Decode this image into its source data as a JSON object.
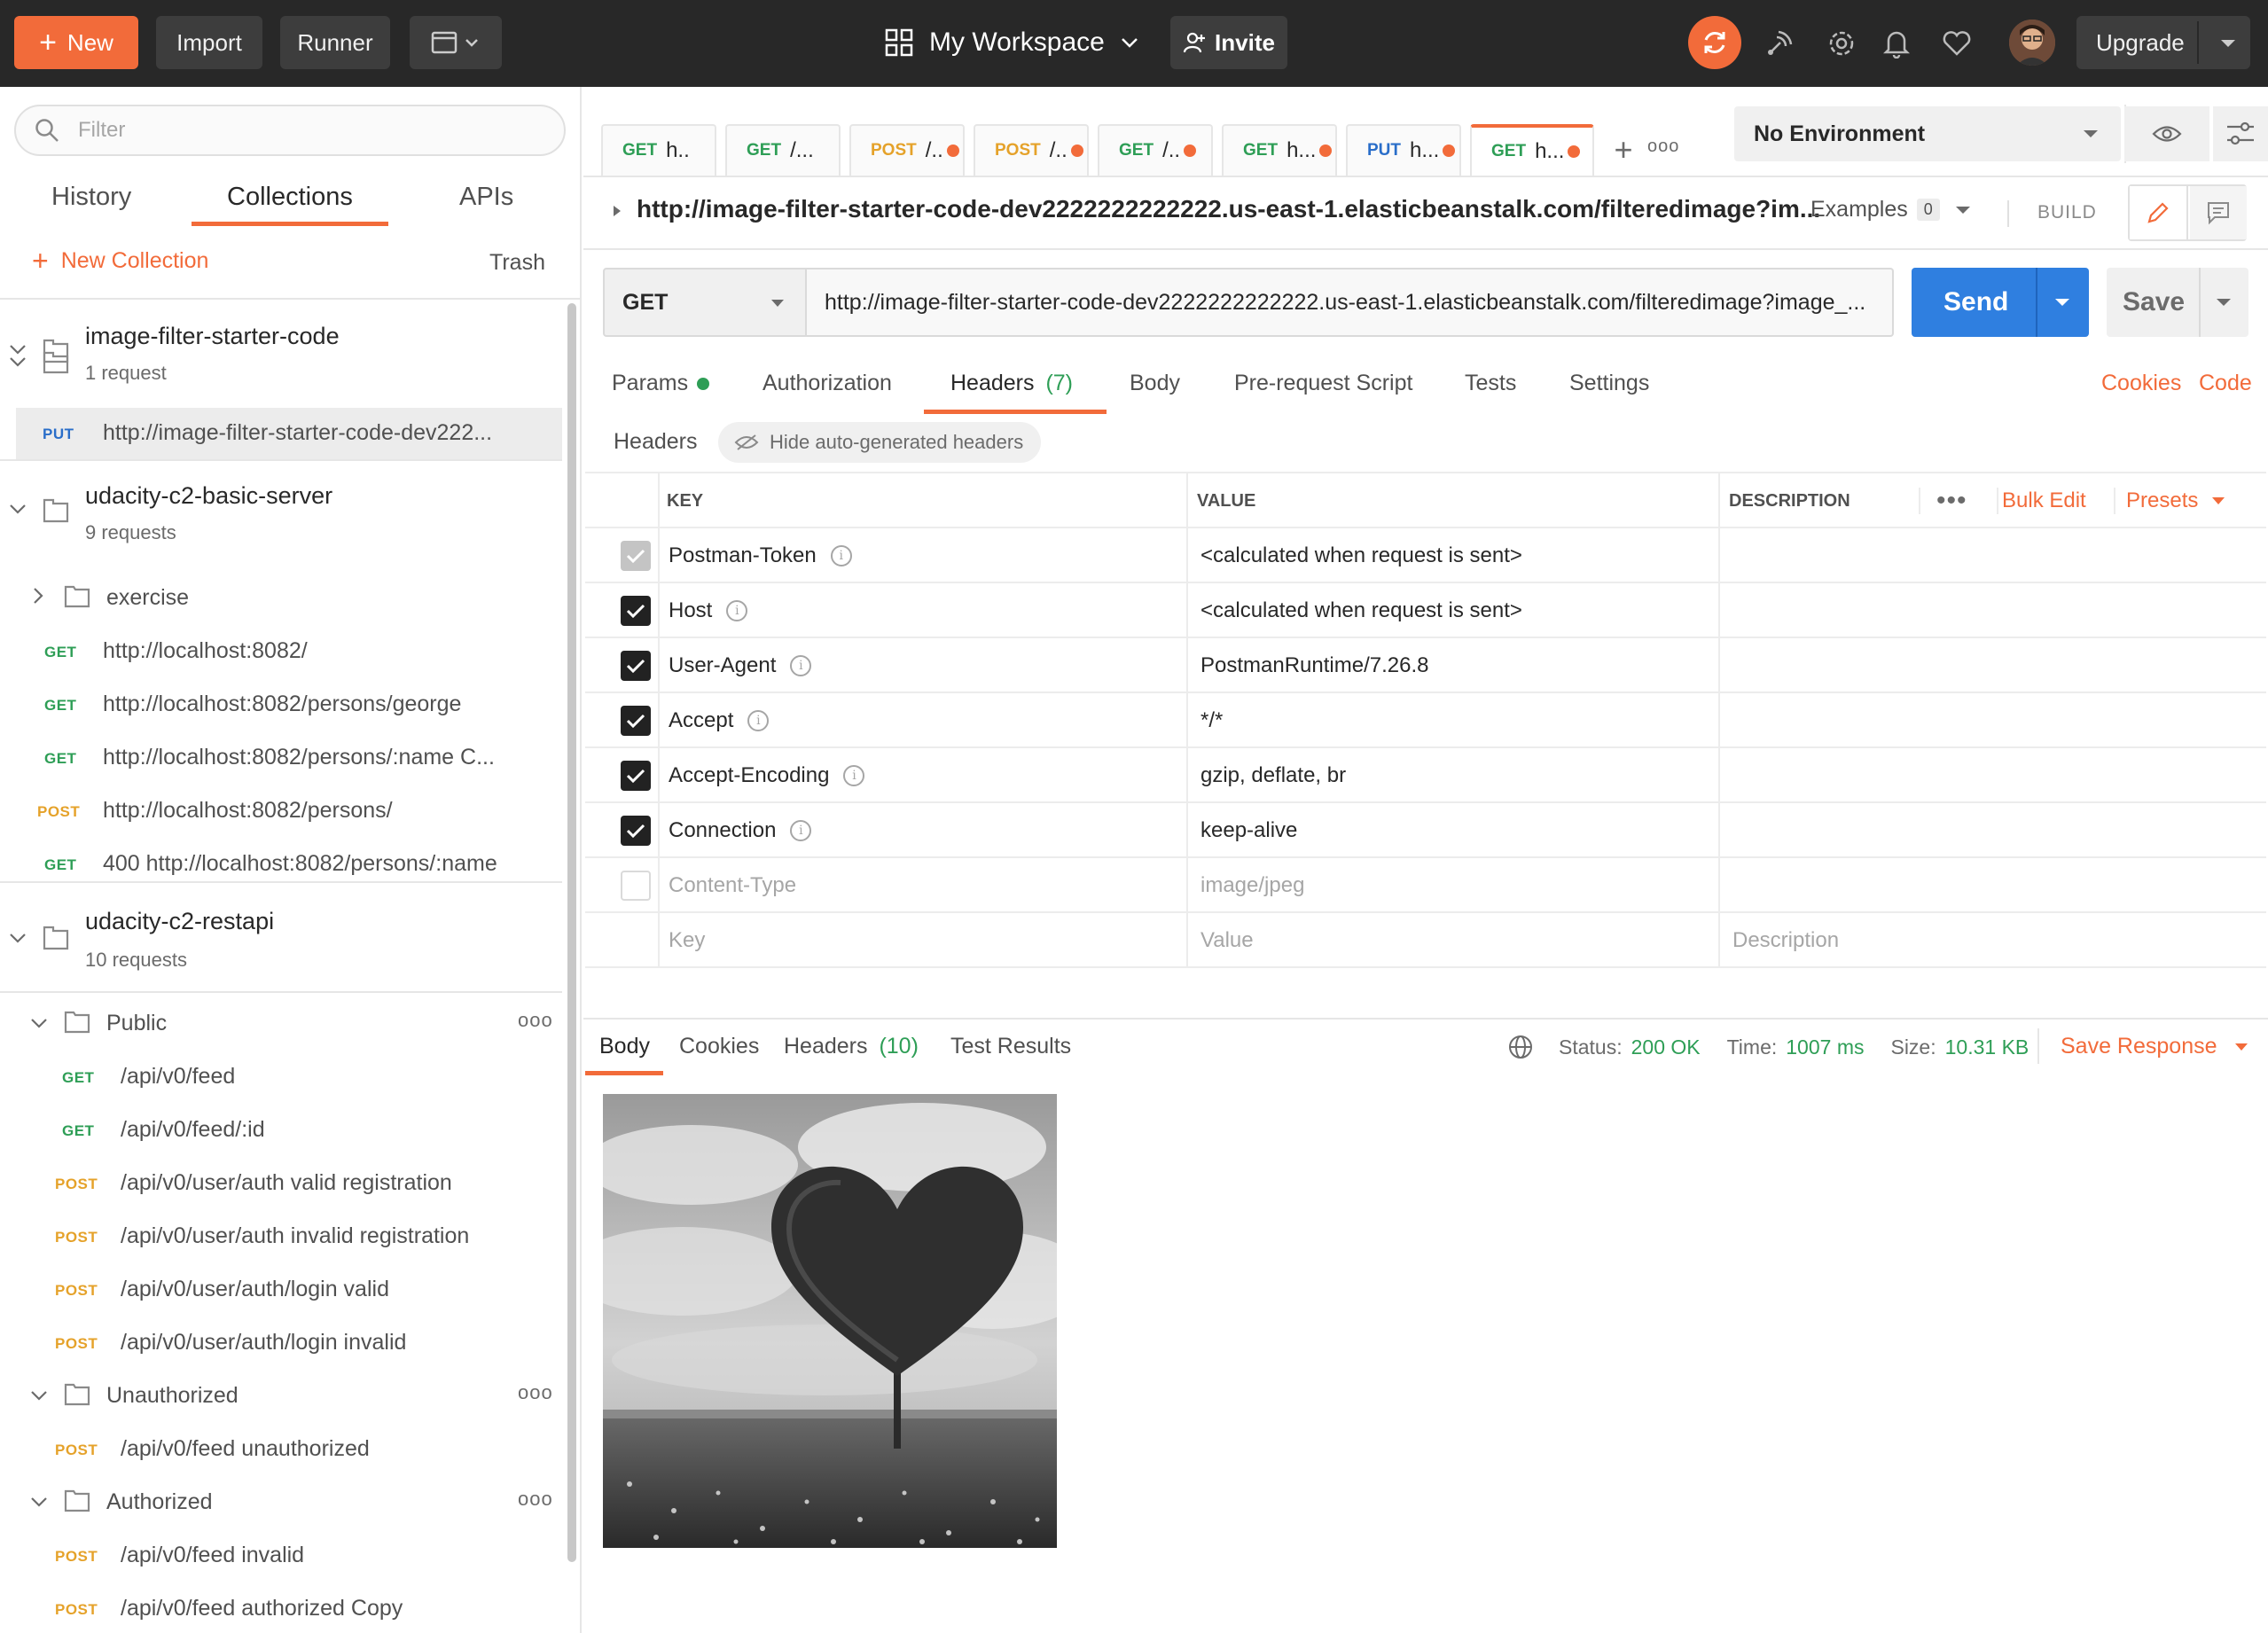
{
  "topbar": {
    "new_label": "New",
    "import_label": "Import",
    "runner_label": "Runner",
    "workspace_label": "My Workspace",
    "invite_label": "Invite",
    "upgrade_label": "Upgrade"
  },
  "sidebar": {
    "filter_placeholder": "Filter",
    "tabs": [
      "History",
      "Collections",
      "APIs"
    ],
    "active_tab": "Collections",
    "new_collection_label": "New Collection",
    "trash_label": "Trash",
    "collections": [
      {
        "name": "image-filter-starter-code",
        "count": "1 request",
        "requests": [
          {
            "method": "PUT",
            "text": "http://image-filter-starter-code-dev222..."
          }
        ]
      },
      {
        "name": "udacity-c2-basic-server",
        "count": "9 requests",
        "folder": "exercise",
        "requests": [
          {
            "method": "GET",
            "text": "http://localhost:8082/"
          },
          {
            "method": "GET",
            "text": "http://localhost:8082/persons/george"
          },
          {
            "method": "GET",
            "text": "http://localhost:8082/persons/:name C..."
          },
          {
            "method": "POST",
            "text": "http://localhost:8082/persons/"
          },
          {
            "method": "GET",
            "text": "400 http://localhost:8082/persons/:name"
          }
        ]
      },
      {
        "name": "udacity-c2-restapi",
        "count": "10 requests",
        "folders": [
          {
            "name": "Public",
            "requests": [
              {
                "method": "GET",
                "text": "/api/v0/feed"
              },
              {
                "method": "GET",
                "text": "/api/v0/feed/:id"
              },
              {
                "method": "POST",
                "text": "/api/v0/user/auth valid registration"
              },
              {
                "method": "POST",
                "text": "/api/v0/user/auth invalid registration"
              },
              {
                "method": "POST",
                "text": "/api/v0/user/auth/login valid"
              },
              {
                "method": "POST",
                "text": "/api/v0/user/auth/login invalid"
              }
            ]
          },
          {
            "name": "Unauthorized",
            "requests": [
              {
                "method": "POST",
                "text": "/api/v0/feed unauthorized"
              }
            ]
          },
          {
            "name": "Authorized",
            "requests": [
              {
                "method": "POST",
                "text": "/api/v0/feed invalid"
              },
              {
                "method": "POST",
                "text": "/api/v0/feed authorized Copy"
              }
            ]
          }
        ]
      }
    ]
  },
  "request_tabs": [
    {
      "method": "GET",
      "title": "h..",
      "unsaved": false
    },
    {
      "method": "GET",
      "title": "/...",
      "unsaved": false
    },
    {
      "method": "POST",
      "title": "/..",
      "unsaved": true
    },
    {
      "method": "POST",
      "title": "/..",
      "unsaved": true
    },
    {
      "method": "GET",
      "title": "/..",
      "unsaved": true
    },
    {
      "method": "GET",
      "title": "h...",
      "unsaved": true
    },
    {
      "method": "PUT",
      "title": "h...",
      "unsaved": true
    },
    {
      "method": "GET",
      "title": "h...",
      "unsaved": true
    }
  ],
  "environment": {
    "selected": "No Environment"
  },
  "request": {
    "breadcrumb_url": "http://image-filter-starter-code-dev2222222222222.us-east-1.elasticbeanstalk.com/filteredimage?im...",
    "examples_label": "Examples",
    "examples_count": "0",
    "build_label": "BUILD",
    "method": "GET",
    "url": "http://image-filter-starter-code-dev2222222222222.us-east-1.elasticbeanstalk.com/filteredimage?image_...",
    "send_label": "Send",
    "save_label": "Save"
  },
  "request_subtabs": {
    "params": "Params",
    "authorization": "Authorization",
    "headers": "Headers",
    "headers_count": "(7)",
    "body": "Body",
    "prerequest": "Pre-request Script",
    "tests": "Tests",
    "settings": "Settings",
    "cookies": "Cookies",
    "code": "Code"
  },
  "headers_section": {
    "title": "Headers",
    "hide_auto_label": "Hide auto-generated headers",
    "columns": {
      "key": "KEY",
      "value": "VALUE",
      "description": "DESCRIPTION"
    },
    "bulk_edit_label": "Bulk Edit",
    "presets_label": "Presets",
    "rows": [
      {
        "key": "Postman-Token",
        "value": "<calculated when request is sent>",
        "state": "auto"
      },
      {
        "key": "Host",
        "value": "<calculated when request is sent>",
        "state": "checked"
      },
      {
        "key": "User-Agent",
        "value": "PostmanRuntime/7.26.8",
        "state": "checked"
      },
      {
        "key": "Accept",
        "value": "*/*",
        "state": "checked"
      },
      {
        "key": "Accept-Encoding",
        "value": "gzip, deflate, br",
        "state": "checked"
      },
      {
        "key": "Connection",
        "value": "keep-alive",
        "state": "checked"
      },
      {
        "key": "Content-Type",
        "value": "image/jpeg",
        "state": "unchecked"
      }
    ],
    "new_row": {
      "key": "Key",
      "value": "Value",
      "description": "Description"
    }
  },
  "response": {
    "tabs": {
      "body": "Body",
      "cookies": "Cookies",
      "headers": "Headers",
      "headers_count": "(10)",
      "test_results": "Test Results"
    },
    "status_label": "Status:",
    "status_value": "200 OK",
    "time_label": "Time:",
    "time_value": "1007 ms",
    "size_label": "Size:",
    "size_value": "10.31 KB",
    "save_response_label": "Save Response"
  },
  "colors": {
    "accent": "#f26b3a",
    "send_blue": "#2f7fe0",
    "get_green": "#2e9e56",
    "post_yellow": "#e5a22a",
    "put_blue": "#2a6ec9"
  }
}
